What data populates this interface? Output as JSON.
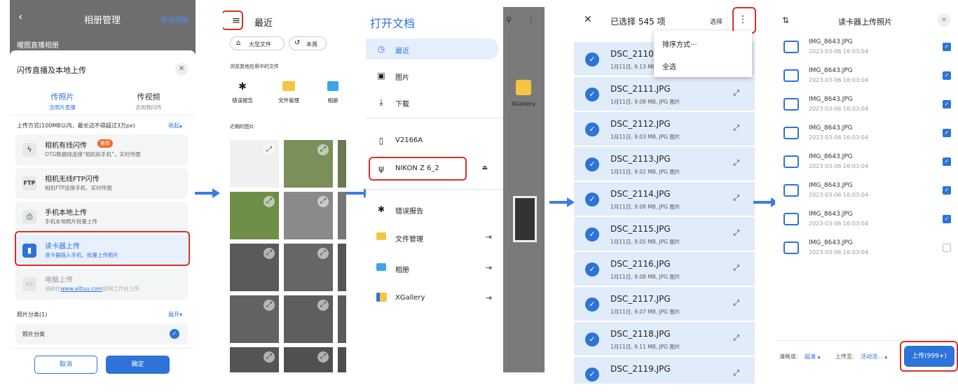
{
  "panel1": {
    "back_icon": "chevron-left-icon",
    "title": "相册管理",
    "preview": "预览相册",
    "album_name": "喔图直播相册",
    "sheet_title": "闪传直播及本地上传",
    "tab_photo": "传照片",
    "tab_photo_sub": "含照片直播",
    "tab_video": "传视频",
    "tab_video_sub": "含视频闪传",
    "upload_mode_label": "上传方式(100MB以内，最长边不得超过3万px)",
    "collapse": "收起",
    "methods": [
      {
        "title": "相机有线闪传",
        "badge": "推荐",
        "sub": "OTG数据线连接“相机和手机”，实时传图",
        "icon": "lightning-icon"
      },
      {
        "title": "相机无线FTP闪传",
        "sub": "相机FTP连接手机、实时传图",
        "icon": "FTP"
      },
      {
        "title": "手机本地上传",
        "sub": "手机本地照片批量上传",
        "icon": "phone-upload-icon"
      },
      {
        "title": "读卡器上传",
        "sub": "读卡器插入手机、批量上传照片",
        "icon": "card-reader-icon"
      },
      {
        "title": "电脑上传",
        "sub_prefix": "请前往",
        "sub_link": "www.alltuu.com",
        "sub_suffix": "官网工作台上传",
        "icon": "computer-icon"
      }
    ],
    "classify_label": "照片分类(1)",
    "expand": "展开",
    "classify_item": "照片分类",
    "cancel": "取消",
    "confirm": "确定"
  },
  "panel2": {
    "title": "最近",
    "chip_large": "大型文件",
    "chip_week": "本周",
    "browse_other": "浏览其他应用中的文件",
    "apps": [
      {
        "label": "错误报告",
        "icon": "bug-icon"
      },
      {
        "label": "文件管理",
        "icon": "folder-icon"
      },
      {
        "label": "相册",
        "icon": "gallery-icon"
      }
    ],
    "recent_images": "近期的图片"
  },
  "panel3": {
    "title": "打开文档",
    "items": [
      {
        "label": "最近",
        "icon": "clock-icon"
      },
      {
        "label": "图片",
        "icon": "image-icon"
      },
      {
        "label": "下载",
        "icon": "download-icon"
      },
      {
        "label": "V2166A",
        "icon": "phone-icon"
      },
      {
        "label": "NIKON Z 6_2",
        "icon": "usb-icon"
      },
      {
        "label": "错误报告",
        "icon": "bug-icon"
      },
      {
        "label": "文件管理",
        "icon": "folder-icon"
      },
      {
        "label": "相册",
        "icon": "gallery-icon"
      },
      {
        "label": "XGallery",
        "icon": "xgallery-icon"
      }
    ],
    "side_label": "XGallery"
  },
  "panel4": {
    "title": "已选择 545 项",
    "select": "选择",
    "menu_sort": "排序方式···",
    "menu_all": "全选",
    "files": [
      {
        "name": "DSC_2110.JPG",
        "meta": "1月11日, 9.13 MB, JPG 图片"
      },
      {
        "name": "DSC_2111.JPG",
        "meta": "1月11日, 9.08 MB, JPG 图片"
      },
      {
        "name": "DSC_2112.JPG",
        "meta": "1月11日, 9.03 MB, JPG 图片"
      },
      {
        "name": "DSC_2113.JPG",
        "meta": "1月11日, 9.02 MB, JPG 图片"
      },
      {
        "name": "DSC_2114.JPG",
        "meta": "1月11日, 9.08 MB, JPG 图片"
      },
      {
        "name": "DSC_2115.JPG",
        "meta": "1月11日, 9.05 MB, JPG 图片"
      },
      {
        "name": "DSC_2116.JPG",
        "meta": "1月11日, 9.08 MB, JPG 图片"
      },
      {
        "name": "DSC_2117.JPG",
        "meta": "1月11日, 9.07 MB, JPG 图片"
      },
      {
        "name": "DSC_2118.JPG",
        "meta": "1月11日, 9.11 MB, JPG 图片"
      },
      {
        "name": "DSC_2119.JPG",
        "meta": ""
      }
    ]
  },
  "panel5": {
    "title": "读卡器上传照片",
    "images": [
      {
        "name": "IMG_8643.JPG",
        "date": "2023-03-06 16:03:04",
        "checked": true
      },
      {
        "name": "IMG_8643.JPG",
        "date": "2023-03-06 16:03:04",
        "checked": true
      },
      {
        "name": "IMG_8643.JPG",
        "date": "2023-03-06 16:03:04",
        "checked": true
      },
      {
        "name": "IMG_8643.JPG",
        "date": "2023-03-06 16:03:04",
        "checked": true
      },
      {
        "name": "IMG_8643.JPG",
        "date": "2023-03-06 16:03:04",
        "checked": true
      },
      {
        "name": "IMG_8643.JPG",
        "date": "2023-03-06 16:03:04",
        "checked": true
      },
      {
        "name": "IMG_8643.JPG",
        "date": "2023-03-06 16:03:04",
        "checked": true
      },
      {
        "name": "IMG_8643.JPG",
        "date": "2023-03-06 16:03:04",
        "checked": false
      }
    ],
    "clarity_label": "清晰度:",
    "clarity_value": "超清",
    "upload_to_label": "上传至:",
    "upload_to_value": "活动活...",
    "upload_button": "上传(999+)"
  },
  "colors": {
    "accent": "#2d73d8",
    "red": "#d93025",
    "arrow": "#3d7ce0"
  }
}
